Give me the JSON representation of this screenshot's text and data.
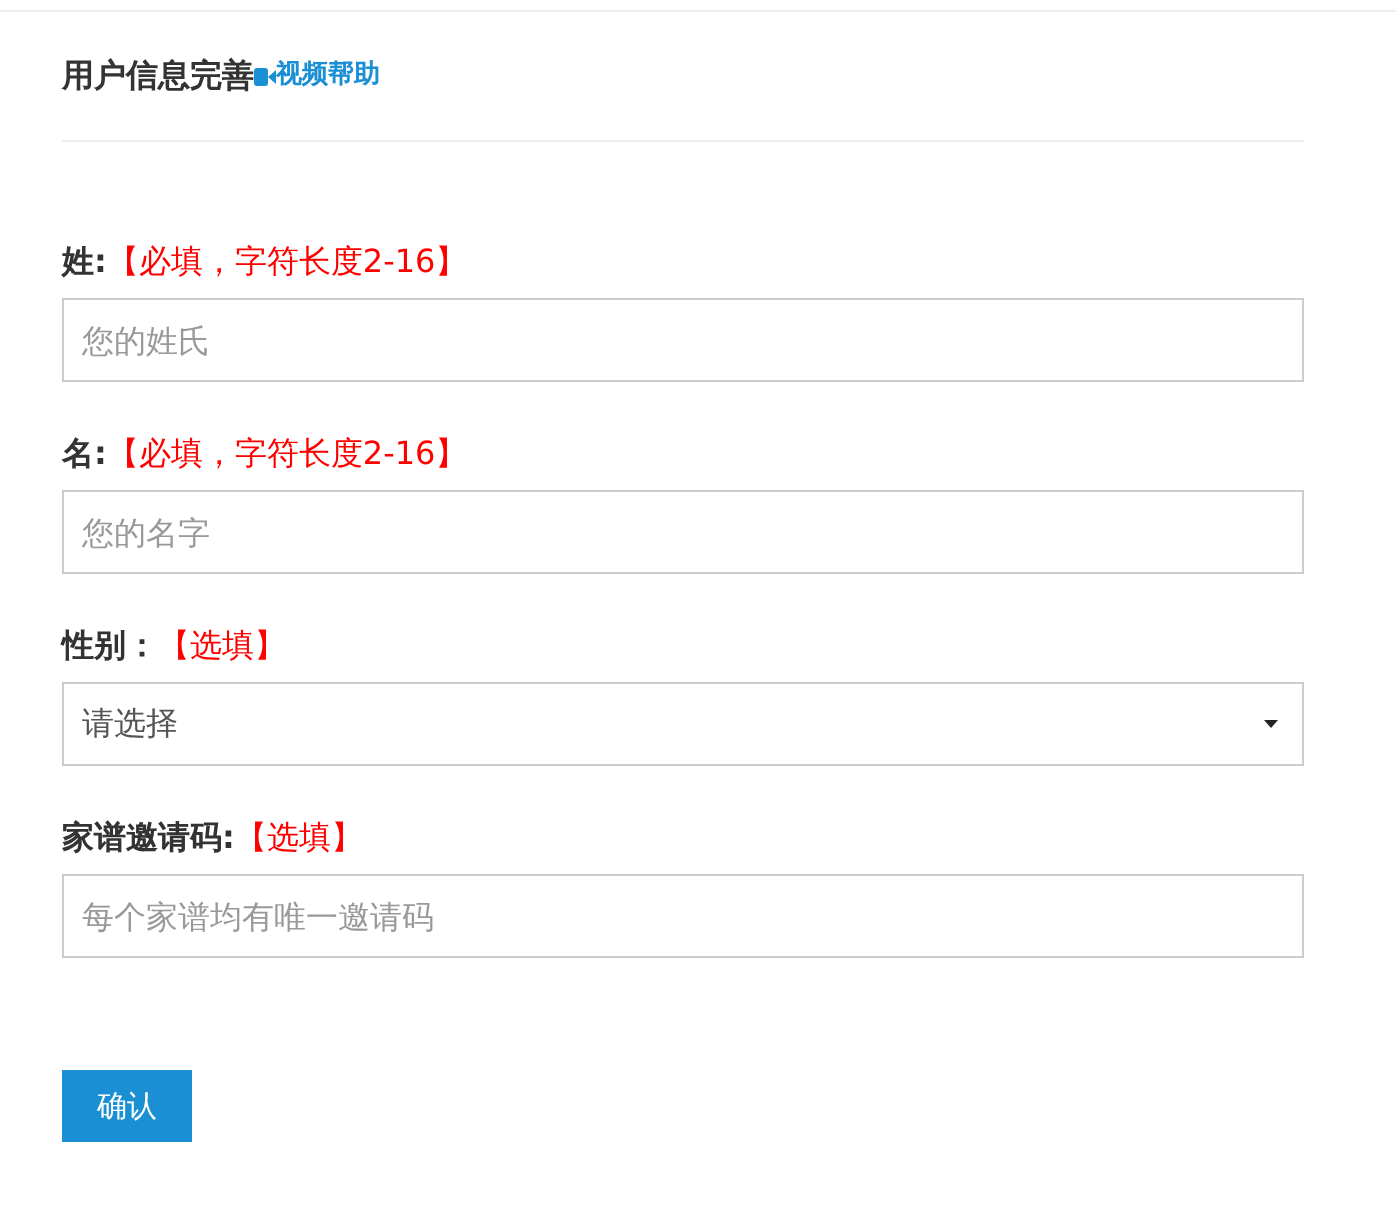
{
  "title": "用户信息完善",
  "help_link": "视频帮助",
  "fields": [
    {
      "kind": "input",
      "label": "姓:",
      "hint": "【必填，字符长度2-16】",
      "placeholder": "您的姓氏"
    },
    {
      "kind": "input",
      "label": "名:",
      "hint": "【必填，字符长度2-16】",
      "placeholder": "您的名字"
    },
    {
      "kind": "select",
      "label": "性别：",
      "hint": "【选填】",
      "value": "请选择"
    },
    {
      "kind": "input",
      "label": "家谱邀请码:",
      "hint": "【选填】",
      "placeholder": "每个家谱均有唯一邀请码"
    }
  ],
  "submit": "确认"
}
